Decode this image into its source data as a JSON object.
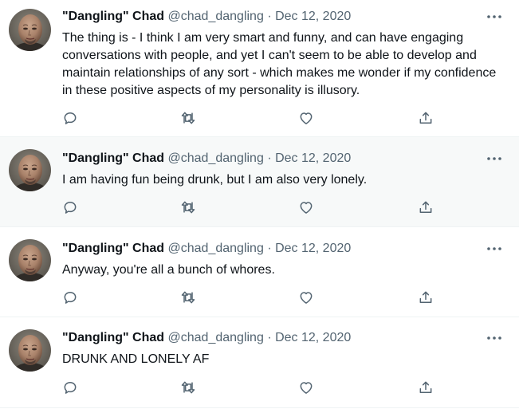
{
  "tweets": [
    {
      "name": "\"Dangling\" Chad",
      "handle": "@chad_dangling",
      "separator": "·",
      "date": "Dec 12, 2020",
      "text": "The thing is - I think I am very smart and funny, and can have engaging conversations with people, and yet I can't seem to be able to develop and maintain relationships of any sort - which makes me wonder if my confidence in these positive aspects of my personality is illusory."
    },
    {
      "name": "\"Dangling\" Chad",
      "handle": "@chad_dangling",
      "separator": "·",
      "date": "Dec 12, 2020",
      "text": "I am having fun being drunk, but I am also very lonely."
    },
    {
      "name": "\"Dangling\" Chad",
      "handle": "@chad_dangling",
      "separator": "·",
      "date": "Dec 12, 2020",
      "text": "Anyway, you're all a bunch of whores."
    },
    {
      "name": "\"Dangling\" Chad",
      "handle": "@chad_dangling",
      "separator": "·",
      "date": "Dec 12, 2020",
      "text": "DRUNK AND LONELY AF"
    }
  ],
  "icons": {
    "reply": "reply-icon",
    "retweet": "retweet-icon",
    "like": "like-icon",
    "share": "share-icon",
    "more": "more-icon"
  },
  "colors": {
    "text": "#0f1419",
    "secondary": "#536471",
    "border": "#eff3f4",
    "highlight_bg": "#f7f9f9"
  }
}
